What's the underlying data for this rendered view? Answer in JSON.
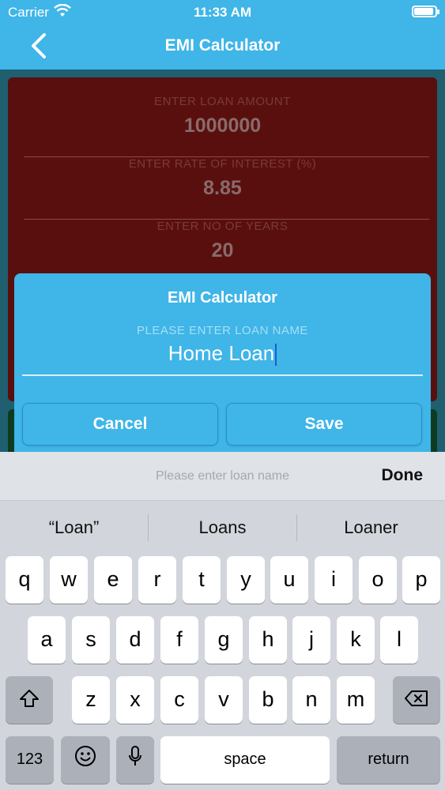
{
  "status": {
    "carrier": "Carrier",
    "time": "11:33 AM"
  },
  "nav": {
    "title": "EMI Calculator",
    "back_icon": "chevron-left-icon"
  },
  "form": {
    "loan_amount_label": "ENTER LOAN AMOUNT",
    "loan_amount_value": "1000000",
    "rate_label": "ENTER RATE OF INTEREST (%)",
    "rate_value": "8.85",
    "years_label": "ENTER NO OF YEARS",
    "years_value": "20"
  },
  "dialog": {
    "title": "EMI Calculator",
    "label": "PLEASE ENTER LOAN NAME",
    "input_value": "Home Loan",
    "cancel_label": "Cancel",
    "save_label": "Save"
  },
  "keyboard": {
    "placeholder": "Please enter loan name",
    "done_label": "Done",
    "suggestions": [
      "“Loan”",
      "Loans",
      "Loaner"
    ],
    "row1": [
      "q",
      "w",
      "e",
      "r",
      "t",
      "y",
      "u",
      "i",
      "o",
      "p"
    ],
    "row2": [
      "a",
      "s",
      "d",
      "f",
      "g",
      "h",
      "j",
      "k",
      "l"
    ],
    "row3": [
      "z",
      "x",
      "c",
      "v",
      "b",
      "n",
      "m"
    ],
    "numbers_label": "123",
    "space_label": "space",
    "return_label": "return"
  },
  "colors": {
    "accent": "#3fb5e8",
    "form_bg": "#5a0f0f",
    "keyboard_bg": "#d2d5db"
  }
}
